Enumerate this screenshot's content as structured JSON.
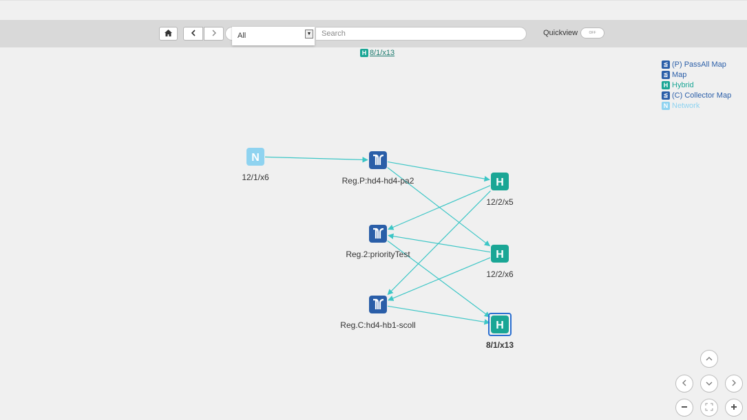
{
  "toolbar": {
    "filter_value": "All",
    "search_placeholder": "Search",
    "quickview_label": "Quickview",
    "quickview_state": "OFF"
  },
  "breadcrumb": {
    "badge": "H",
    "link": "8/1/x13"
  },
  "legend": [
    {
      "badge": "⪍",
      "label": "(P) PassAll Map",
      "color": "#2a5ea8",
      "text_color": "#2a5ea8"
    },
    {
      "badge": "⪍",
      "label": "Map",
      "color": "#2a5ea8",
      "text_color": "#2a5ea8"
    },
    {
      "badge": "H",
      "label": "Hybrid",
      "color": "#1aa695",
      "text_color": "#1aa695"
    },
    {
      "badge": "⪍",
      "label": "(C) Collector Map",
      "color": "#2a5ea8",
      "text_color": "#2a5ea8"
    },
    {
      "badge": "N",
      "label": "Network",
      "color": "#8fd3f0",
      "text_color": "#8fd3f0"
    }
  ],
  "nodes": [
    {
      "id": "n1",
      "type": "network",
      "label": "12/1/x6",
      "icon": "N"
    },
    {
      "id": "p1",
      "type": "map",
      "label": "Reg.P:hd4-hd4-pa2",
      "icon": "map-icon"
    },
    {
      "id": "m2",
      "type": "map",
      "label": "Reg.2:priorityTest",
      "icon": "map-icon"
    },
    {
      "id": "c1",
      "type": "map",
      "label": "Reg.C:hd4-hb1-scoll",
      "icon": "map-icon"
    },
    {
      "id": "h1",
      "type": "hybrid",
      "label": "12/2/x5",
      "icon": "H"
    },
    {
      "id": "h2",
      "type": "hybrid",
      "label": "12/2/x6",
      "icon": "H"
    },
    {
      "id": "h3",
      "type": "hybrid",
      "label": "8/1/x13",
      "icon": "H",
      "selected": true
    }
  ],
  "edges": [
    [
      "n1",
      "p1"
    ],
    [
      "p1",
      "h1"
    ],
    [
      "p1",
      "h2"
    ],
    [
      "h1",
      "m2"
    ],
    [
      "h1",
      "c1"
    ],
    [
      "h2",
      "m2"
    ],
    [
      "h2",
      "c1"
    ],
    [
      "m2",
      "h3"
    ],
    [
      "c1",
      "h3"
    ]
  ],
  "colors": {
    "map": "#2a5ea8",
    "hybrid": "#1aa695",
    "network": "#8fd3f0",
    "edge": "#3cc6c6",
    "selected_border": "#2a6fd1"
  },
  "nav_controls": [
    "pan-up",
    "pan-left",
    "pan-down",
    "pan-right",
    "zoom-out",
    "fit-to-screen",
    "zoom-in"
  ]
}
